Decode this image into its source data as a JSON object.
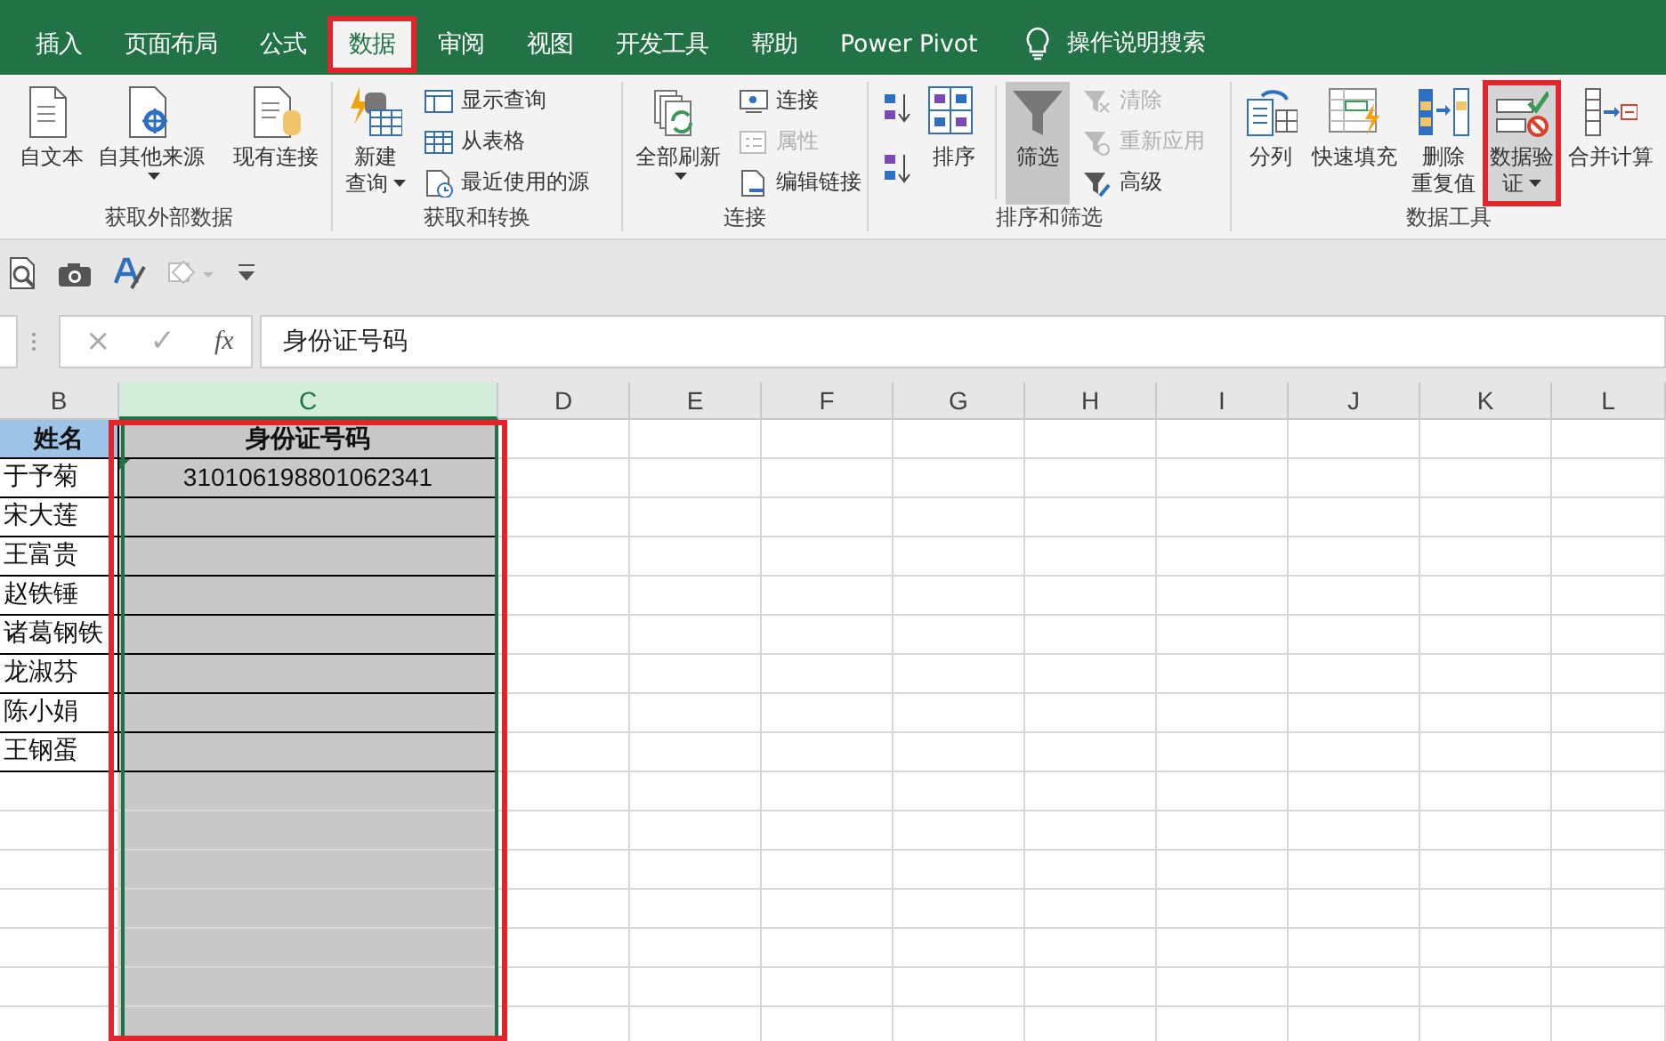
{
  "tabs": [
    {
      "label": "插入",
      "selected": false
    },
    {
      "label": "页面布局",
      "selected": false
    },
    {
      "label": "公式",
      "selected": false
    },
    {
      "label": "数据",
      "selected": true,
      "highlighted": true
    },
    {
      "label": "审阅",
      "selected": false
    },
    {
      "label": "视图",
      "selected": false
    },
    {
      "label": "开发工具",
      "selected": false
    },
    {
      "label": "帮助",
      "selected": false
    },
    {
      "label": "Power Pivot",
      "selected": false
    }
  ],
  "tell_me": {
    "placeholder": "操作说明搜索"
  },
  "ribbon_groups": [
    {
      "name": "获取外部数据",
      "items": [
        {
          "kind": "large",
          "lines": [
            "自文本"
          ]
        },
        {
          "kind": "large",
          "lines": [
            "自其他来源"
          ],
          "menu": true
        },
        {
          "kind": "separator"
        },
        {
          "kind": "large",
          "lines": [
            "现有连接"
          ]
        }
      ]
    },
    {
      "name": "获取和转换",
      "items": [
        {
          "kind": "large",
          "lines": [
            "新建",
            "查询"
          ],
          "menu": true
        },
        {
          "kind": "small",
          "label": "显示查询",
          "disabled": false
        },
        {
          "kind": "small",
          "label": "从表格",
          "disabled": false
        },
        {
          "kind": "small",
          "label": "最近使用的源",
          "disabled": false
        }
      ]
    },
    {
      "name": "连接",
      "items": [
        {
          "kind": "large",
          "lines": [
            "全部刷新"
          ],
          "menu": true
        },
        {
          "kind": "small",
          "label": "连接",
          "disabled": false
        },
        {
          "kind": "small",
          "label": "属性",
          "disabled": true
        },
        {
          "kind": "small",
          "label": "编辑链接",
          "disabled": false
        }
      ]
    },
    {
      "name": "排序和筛选",
      "items": [
        {
          "kind": "sortpair"
        },
        {
          "kind": "large",
          "lines": [
            "排序"
          ]
        },
        {
          "kind": "separator"
        },
        {
          "kind": "large",
          "lines": [
            "筛选"
          ],
          "active": true
        },
        {
          "kind": "small",
          "label": "清除",
          "disabled": true
        },
        {
          "kind": "small",
          "label": "重新应用",
          "disabled": true
        },
        {
          "kind": "small",
          "label": "高级",
          "disabled": false
        }
      ]
    },
    {
      "name": "数据工具",
      "items": [
        {
          "kind": "large",
          "lines": [
            "分列"
          ]
        },
        {
          "kind": "large",
          "lines": [
            "快速填充"
          ]
        },
        {
          "kind": "large",
          "lines": [
            "删除",
            "重复值"
          ]
        },
        {
          "kind": "large",
          "lines": [
            "数据验",
            "证"
          ],
          "menu": true,
          "highlighted": true
        },
        {
          "kind": "large",
          "lines": [
            "合并计算"
          ]
        }
      ]
    }
  ],
  "formula_bar": {
    "cancel": "×",
    "enter": "✓",
    "function": "fx",
    "value": "身份证号码"
  },
  "sheet": {
    "columns": [
      {
        "label": "B",
        "selected": false,
        "highlighted": false
      },
      {
        "label": "C",
        "selected": true,
        "highlighted": true
      },
      {
        "label": "D",
        "selected": false,
        "highlighted": false
      },
      {
        "label": "E",
        "selected": false,
        "highlighted": false
      },
      {
        "label": "F",
        "selected": false,
        "highlighted": false
      },
      {
        "label": "G",
        "selected": false,
        "highlighted": false
      },
      {
        "label": "H",
        "selected": false,
        "highlighted": false
      },
      {
        "label": "I",
        "selected": false,
        "highlighted": false
      },
      {
        "label": "J",
        "selected": false,
        "highlighted": false
      },
      {
        "label": "K",
        "selected": false,
        "highlighted": false
      },
      {
        "label": "L",
        "selected": false,
        "highlighted": false
      }
    ],
    "header": {
      "name": "姓名",
      "id_number": "身份证号码"
    },
    "rows": [
      {
        "name": "于予菊",
        "id_number": "310106198801062341",
        "flagged": true
      },
      {
        "name": "宋大莲",
        "flagged": false
      },
      {
        "name": "王富贵",
        "flagged": false
      },
      {
        "name": "赵铁锤",
        "flagged": false
      },
      {
        "name": "诸葛钢铁",
        "flagged": false
      },
      {
        "name": "龙淑芬",
        "flagged": false
      },
      {
        "name": "陈小娟",
        "flagged": false
      },
      {
        "name": "王钢蛋",
        "flagged": false
      }
    ]
  }
}
